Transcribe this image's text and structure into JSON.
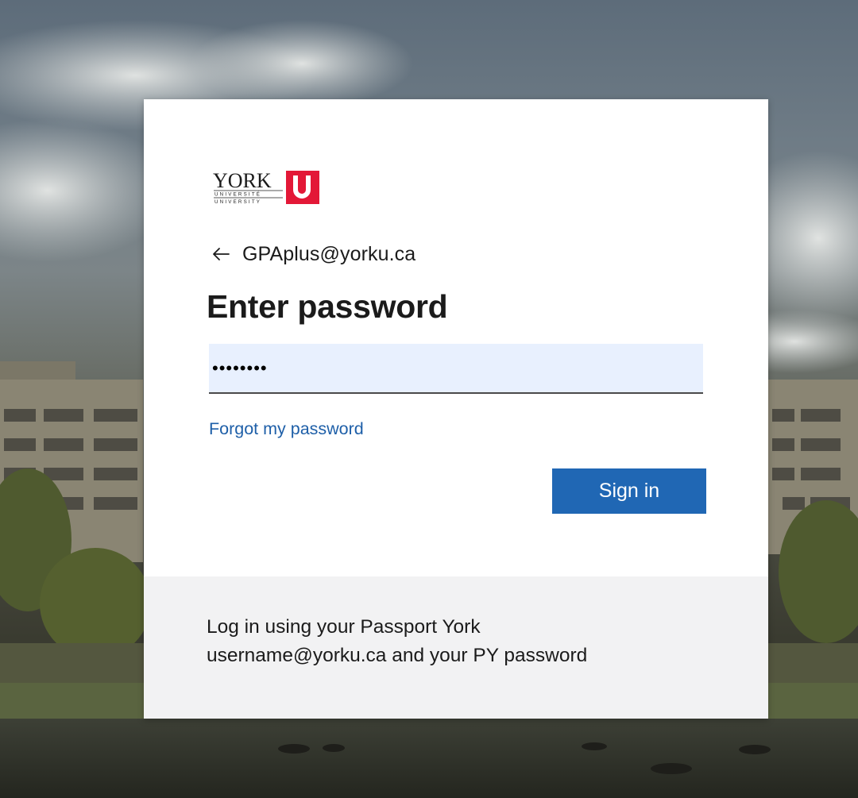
{
  "logo": {
    "wordmark": "YORK",
    "sub_line_1": "UNIVERSITÉ",
    "sub_line_2": "UNIVERSITY",
    "mark_letter": "U",
    "brand_color": "#e31837"
  },
  "identity": {
    "back_icon": "back-arrow-icon",
    "account": "GPAplus@yorku.ca"
  },
  "title": "Enter password",
  "password": {
    "value": "••••••••"
  },
  "forgot_link": "Forgot my password",
  "signin_button": "Sign in",
  "footer": {
    "line1": "Log in using your Passport York",
    "line2": "username@yorku.ca and your PY password"
  },
  "colors": {
    "accent": "#2067b4",
    "link": "#1e5fa8",
    "field_bg": "#e8f0fe"
  }
}
